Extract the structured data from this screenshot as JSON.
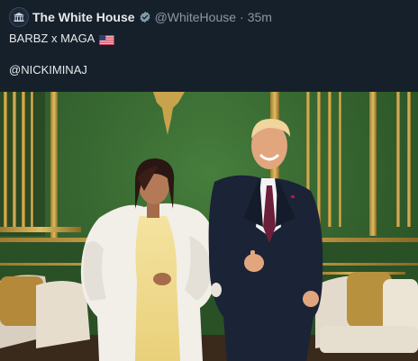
{
  "tweet": {
    "display_name": "The White House",
    "handle": "@WhiteHouse",
    "separator": "·",
    "timestamp": "35m",
    "text_line1": "BARBZ x MAGA",
    "text_line2": "@NICKIMINAJ",
    "icons": {
      "avatar": "white-house-logo-icon",
      "verified": "verified-badge-icon",
      "flag": "us-flag-icon"
    }
  },
  "colors": {
    "background": "#15202b",
    "text_primary": "#e7e9ea",
    "text_secondary": "#8b98a5",
    "verified_badge": "#829aab"
  }
}
